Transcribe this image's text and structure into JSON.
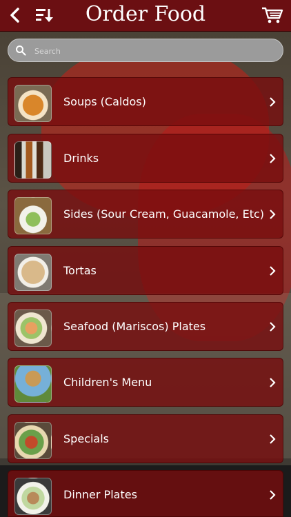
{
  "header": {
    "title": "Order Food",
    "back_icon": "chevron-left-icon",
    "sort_icon": "sort-icon",
    "cart_icon": "shopping-cart-icon"
  },
  "search": {
    "placeholder": "Search",
    "icon": "search-icon"
  },
  "categories": [
    {
      "label": "Soups (Caldos)",
      "thumb": "soup-photo"
    },
    {
      "label": "Drinks",
      "thumb": "drinks-photo"
    },
    {
      "label": "Sides (Sour Cream, Guacamole, Etc)",
      "thumb": "sides-photo"
    },
    {
      "label": "Tortas",
      "thumb": "tortas-photo"
    },
    {
      "label": "Seafood (Mariscos) Plates",
      "thumb": "seafood-photo"
    },
    {
      "label": "Children's Menu",
      "thumb": "kids-photo"
    },
    {
      "label": "Specials",
      "thumb": "specials-photo"
    },
    {
      "label": "Dinner Plates",
      "thumb": "dinner-photo"
    }
  ],
  "colors": {
    "header_bg": "#6b0f12",
    "row_bg": "#780c0e",
    "search_bg": "#9b9b9b"
  }
}
